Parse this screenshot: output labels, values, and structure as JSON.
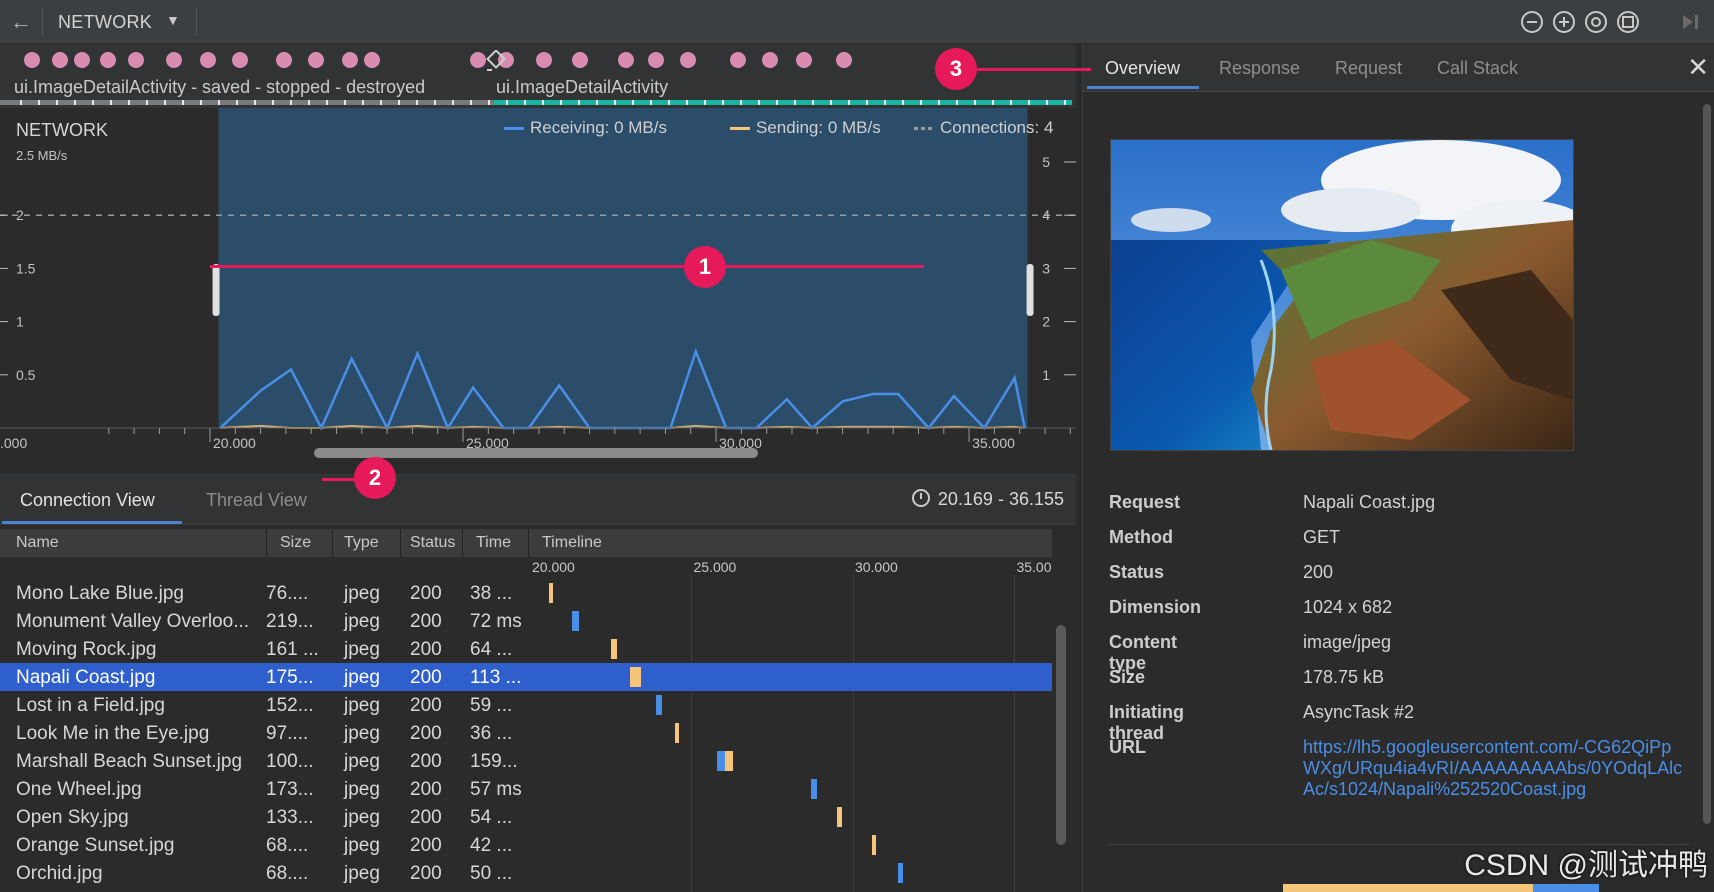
{
  "toolbar": {
    "back_icon": "back-arrow-icon",
    "profiler": "NETWORK",
    "caret_icon": "chevron-down-icon",
    "icons": [
      "zoom-out-icon",
      "zoom-in-icon",
      "reset-zoom-icon",
      "fit-icon",
      "jump-to-live-icon"
    ]
  },
  "events": {
    "activities": [
      "ui.ImageDetailActivity - saved - stopped - destroyed",
      "ui.ImageDetailActivity"
    ],
    "rotate_icon": "rotate-screen-icon"
  },
  "chart": {
    "title": "NETWORK",
    "unit": "2.5 MB/s",
    "legend": {
      "receiving": "Receiving: 0 MB/s",
      "sending": "Sending: 0 MB/s",
      "connections": "Connections: 4"
    },
    "colors": {
      "receiving": "#4a8fe7",
      "sending": "#f5c67a",
      "connections": "#9a9a9a",
      "selection": "#2b4f6e"
    },
    "left_ticks": [
      "2",
      "1.5",
      "1",
      "0.5"
    ],
    "right_ticks": [
      "5",
      "4",
      "3",
      "2",
      "1"
    ],
    "x_ticks": [
      ".000",
      "20.000",
      "25.000",
      "30.000",
      "35.000"
    ]
  },
  "chart_data": {
    "type": "line",
    "title": "NETWORK",
    "ylabel": "2.5 MB/s",
    "ylim": [
      0,
      2.5
    ],
    "y2lim": [
      0,
      5
    ],
    "x": [
      20.2,
      21.0,
      21.6,
      22.2,
      22.8,
      23.5,
      24.1,
      24.7,
      25.2,
      25.8,
      26.3,
      26.9,
      27.5,
      28.1,
      28.6,
      29.1,
      29.6,
      30.2,
      30.8,
      31.4,
      31.9,
      32.5,
      33.1,
      33.6,
      34.2,
      34.7,
      35.3,
      35.9,
      36.1
    ],
    "series": [
      {
        "name": "Receiving",
        "values": [
          0.0,
          0.35,
          0.55,
          0.0,
          0.65,
          0.0,
          0.7,
          0.0,
          0.38,
          0.0,
          0.0,
          0.4,
          0.0,
          0.0,
          0.0,
          0.0,
          0.72,
          0.0,
          0.0,
          0.27,
          0.0,
          0.25,
          0.32,
          0.32,
          0.0,
          0.3,
          0.0,
          0.47,
          0.0
        ]
      },
      {
        "name": "Sending",
        "values": [
          0,
          0.02,
          0,
          0,
          0.02,
          0,
          0.02,
          0,
          0.01,
          0,
          0,
          0.01,
          0,
          0,
          0,
          0,
          0.02,
          0,
          0,
          0.01,
          0,
          0.01,
          0.01,
          0.01,
          0,
          0.01,
          0,
          0.01,
          0
        ]
      }
    ],
    "xticks": [
      20.0,
      25.0,
      30.0,
      35.0
    ],
    "selection": [
      20.169,
      36.155
    ]
  },
  "lower": {
    "tabs": [
      "Connection View",
      "Thread View"
    ],
    "range": "20.169 - 36.155",
    "columns": [
      "Name",
      "Size",
      "Type",
      "Status",
      "Time",
      "Timeline"
    ],
    "timeline_ticks": [
      "20.000",
      "25.000",
      "30.000",
      "35.00"
    ],
    "rows": [
      {
        "name": "Mono Lake Blue.jpg",
        "size": "76....",
        "type": "jpeg",
        "status": "200",
        "time": "38 ...",
        "start": 20.6,
        "dur": 0.04
      },
      {
        "name": "Monument Valley Overloo...",
        "size": "219...",
        "type": "jpeg",
        "status": "200",
        "time": "72 ms",
        "start": 21.3,
        "dur": 0.07
      },
      {
        "name": "Moving Rock.jpg",
        "size": "161 ...",
        "type": "jpeg",
        "status": "200",
        "time": "64 ...",
        "start": 22.5,
        "dur": 0.06
      },
      {
        "name": "Napali Coast.jpg",
        "size": "175...",
        "type": "jpeg",
        "status": "200",
        "time": "113 ...",
        "start": 23.1,
        "dur": 0.11,
        "selected": true
      },
      {
        "name": "Lost in a Field.jpg",
        "size": "152...",
        "type": "jpeg",
        "status": "200",
        "time": "59 ...",
        "start": 23.9,
        "dur": 0.06
      },
      {
        "name": "Look Me in the Eye.jpg",
        "size": "97....",
        "type": "jpeg",
        "status": "200",
        "time": "36 ...",
        "start": 24.5,
        "dur": 0.04
      },
      {
        "name": "Marshall Beach Sunset.jpg",
        "size": "100...",
        "type": "jpeg",
        "status": "200",
        "time": "159...",
        "start": 25.8,
        "dur": 0.16
      },
      {
        "name": "One Wheel.jpg",
        "size": "173...",
        "type": "jpeg",
        "status": "200",
        "time": "57 ms",
        "start": 28.7,
        "dur": 0.06
      },
      {
        "name": "Open Sky.jpg",
        "size": "133...",
        "type": "jpeg",
        "status": "200",
        "time": "54 ...",
        "start": 29.5,
        "dur": 0.05
      },
      {
        "name": "Orange Sunset.jpg",
        "size": "68....",
        "type": "jpeg",
        "status": "200",
        "time": "42 ...",
        "start": 30.6,
        "dur": 0.04
      },
      {
        "name": "Orchid.jpg",
        "size": "68....",
        "type": "jpeg",
        "status": "200",
        "time": "50 ...",
        "start": 31.4,
        "dur": 0.05
      }
    ]
  },
  "detail": {
    "tabs": [
      "Overview",
      "Response",
      "Request",
      "Call Stack"
    ],
    "close_icon": "close-icon",
    "fields": [
      {
        "key": "Request",
        "value": "Napali Coast.jpg"
      },
      {
        "key": "Method",
        "value": "GET"
      },
      {
        "key": "Status",
        "value": "200"
      },
      {
        "key": "Dimension",
        "value": "1024 x 682"
      },
      {
        "key": "Content type",
        "value": "image/jpeg"
      },
      {
        "key": "Size",
        "value": "178.75 kB"
      },
      {
        "key": "Initiating thread",
        "value": "AsyncTask #2"
      }
    ],
    "url_key": "URL",
    "url": "https://lh5.googleusercontent.com/-CG62QiPpWXg/URqu4ia4vRI/AAAAAAAAAbs/0YOdqLAlcAc/s1024/Napali%252520Coast.jpg",
    "timing_colors": [
      "#f5c67a",
      "#4a8fe7"
    ]
  },
  "callouts": [
    "1",
    "2",
    "3"
  ],
  "watermark": "CSDN @测试冲鸭"
}
